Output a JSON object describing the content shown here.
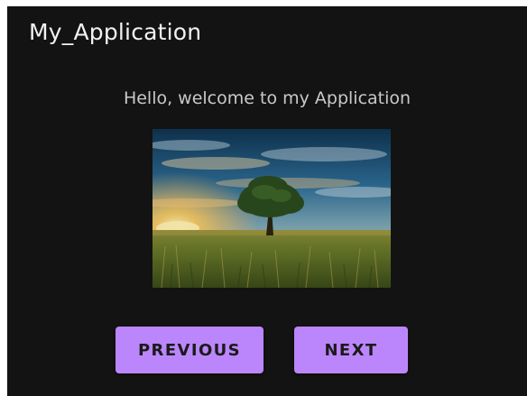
{
  "app_bar": {
    "title": "My_Application"
  },
  "main": {
    "welcome_text": "Hello, welcome to my Application",
    "image": {
      "subject": "lone tree in grass field at sunset"
    },
    "previous_label": "PREVIOUS",
    "next_label": "NEXT"
  },
  "colors": {
    "background": "#131313",
    "text_primary": "#f2f2f2",
    "text_secondary": "#c9c9c9",
    "button_accent": "#bb86fc",
    "button_text": "#1a1a1a"
  }
}
